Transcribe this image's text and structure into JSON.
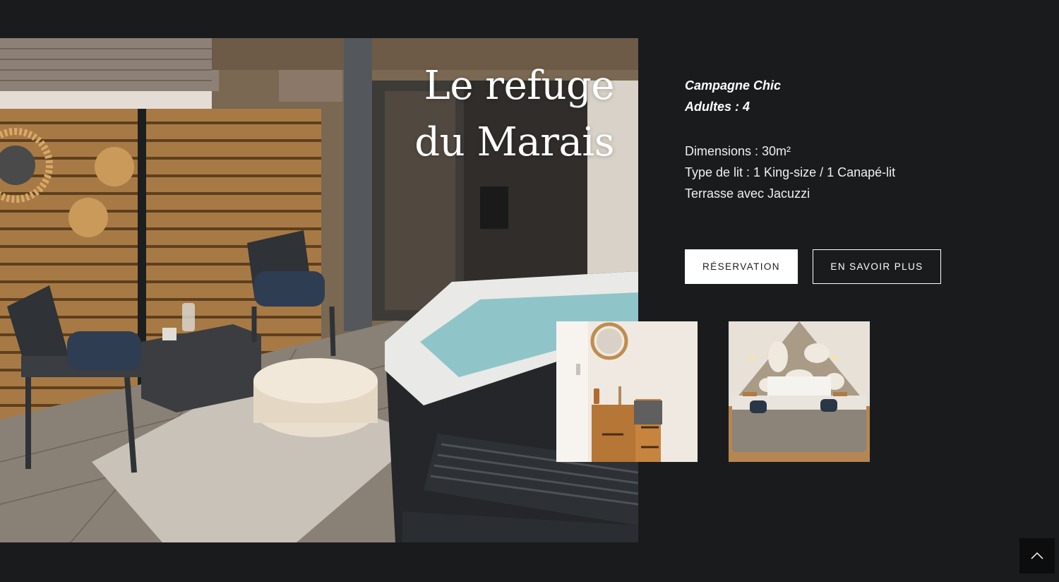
{
  "room": {
    "title_line1": "Le refuge",
    "title_line2": "du Marais",
    "style_tag": "Campagne Chic",
    "capacity": "Adultes : 4",
    "specs": [
      "Dimensions : 30m²",
      "Type de lit : 1 King-size / 1 Canapé-lit",
      "Terrasse avec Jacuzzi"
    ]
  },
  "actions": {
    "reserve_label": "RÉSERVATION",
    "more_label": "EN SAVOIR PLUS"
  },
  "gallery": {
    "main_icon": "terrace-jacuzzi-photo",
    "thumbs": [
      "bathroom-photo",
      "bedroom-photo"
    ]
  },
  "scroll_top_icon": "chevron-up-icon",
  "colors": {
    "background": "#1a1b1d",
    "button_primary_bg": "#ffffff",
    "button_primary_text": "#1a1b1d",
    "text": "#ffffff"
  }
}
